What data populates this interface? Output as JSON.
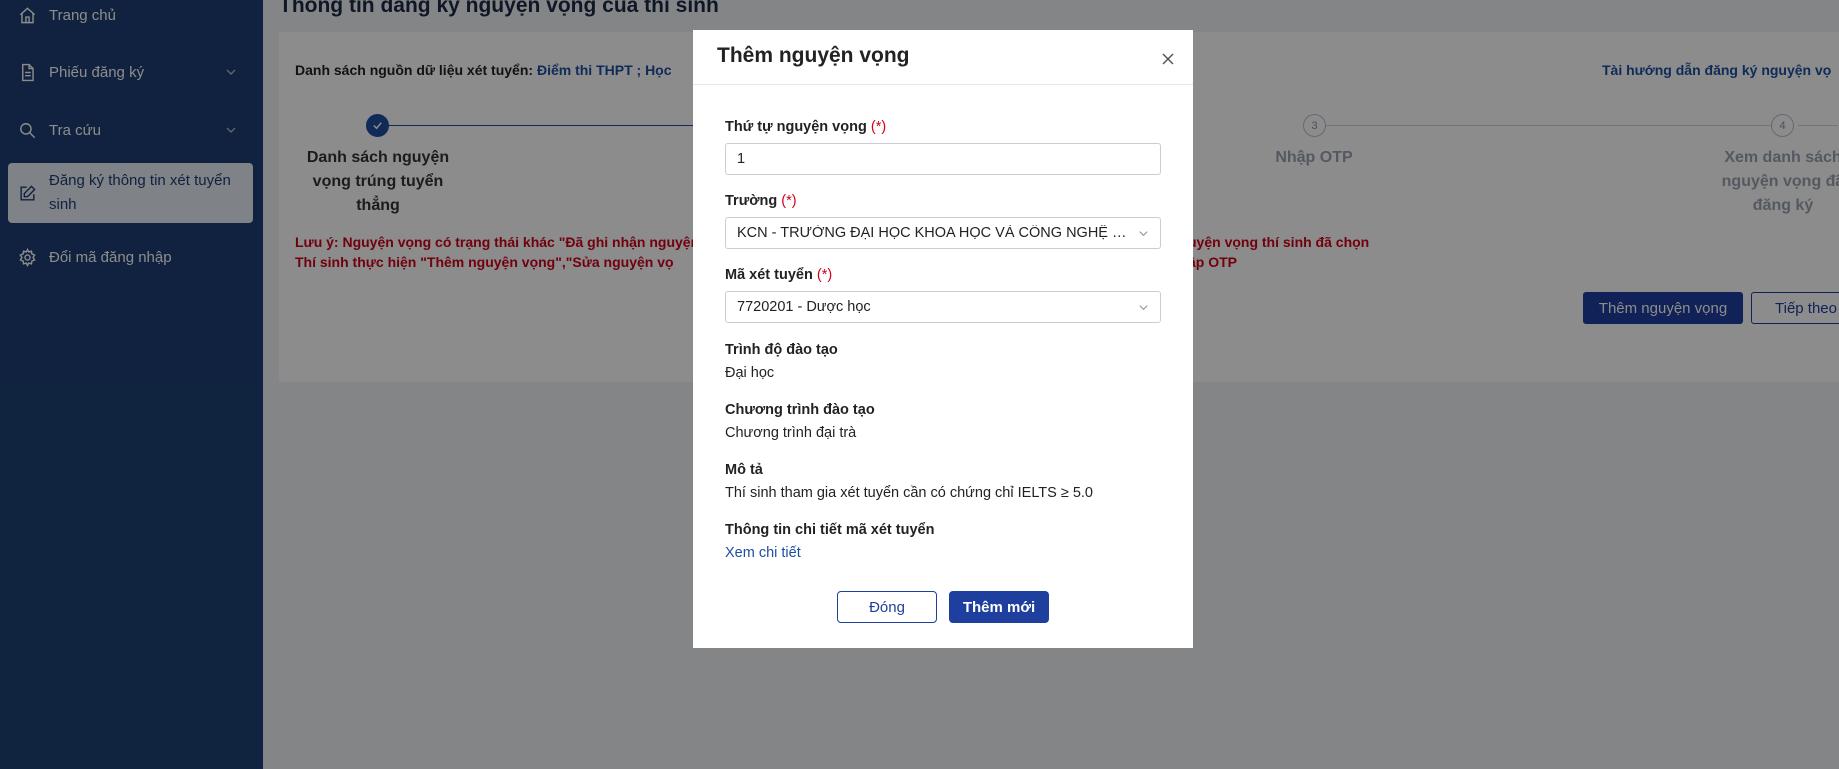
{
  "sidebar": {
    "items": [
      {
        "label": "Trang chủ",
        "icon": "home-icon"
      },
      {
        "label": "Phiếu đăng ký",
        "icon": "document-icon",
        "expandable": true
      },
      {
        "label": "Tra cứu",
        "icon": "search-icon",
        "expandable": true
      },
      {
        "label": "Đăng ký thông tin xét tuyển sinh",
        "icon": "edit-icon",
        "active": true
      },
      {
        "label": "Đổi mã đăng nhập",
        "icon": "gear-icon"
      }
    ]
  },
  "page": {
    "title": "Thông tin đăng ký nguyện vọng của thí sinh",
    "source_label": "Danh sách nguồn dữ liệu xét tuyển:",
    "source_links": "Điểm thi THPT ; Học",
    "guide_link": "Tài hướng dẫn đăng ký nguyện vọ",
    "steps": [
      {
        "number": "✓",
        "label": "Danh sách nguyện vọng trúng tuyển thẳng",
        "done": true
      },
      {
        "number": "3",
        "label": "Nhập OTP",
        "done": false
      },
      {
        "number": "4",
        "label": "Xem danh sách nguyện vọng đã đăng ký",
        "done": false
      }
    ],
    "note_line1": "Lưu ý: Nguyện vọng có trạng thái khác \"Đã ghi nhận nguyện",
    "note_line2": "Thí sinh thực hiện \"Thêm nguyện vọng\",\"Sửa nguyện vọ",
    "note_right_line1": "uyện vọng thí sinh đã chọn",
    "note_right_line2": "ập OTP",
    "add_button": "Thêm nguyện vọng",
    "next_button": "Tiếp theo"
  },
  "modal": {
    "title": "Thêm nguyện vọng",
    "order_label": "Thứ tự nguyện vọng",
    "order_value": "1",
    "school_label": "Trường",
    "school_value": "KCN - TRƯỜNG ĐẠI HỌC KHOA HỌC VÀ CÔNG NGHỆ H...",
    "code_label": "Mã xét tuyển",
    "code_value": "7720201 - Dược học",
    "required_mark": "(*)",
    "level_label": "Trình độ đào tạo",
    "level_value": "Đại học",
    "program_label": "Chương trình đào tạo",
    "program_value": "Chương trình đại trà",
    "desc_label": "Mô tả",
    "desc_value": "Thí sinh tham gia xét tuyển cần có chứng chỉ IELTS ≥ 5.0",
    "detail_label": "Thông tin chi tiết mã xét tuyển",
    "detail_link": "Xem chi tiết",
    "close_button": "Đóng",
    "submit_button": "Thêm mới"
  }
}
